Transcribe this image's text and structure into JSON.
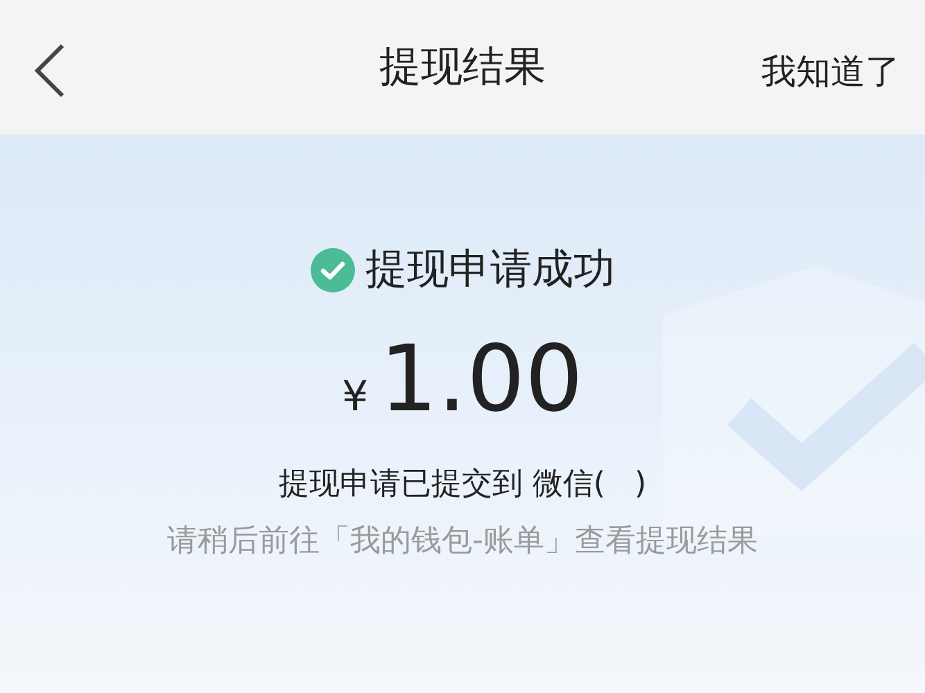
{
  "header": {
    "title": "提现结果",
    "action": "我知道了"
  },
  "result": {
    "status": "提现申请成功",
    "success": true,
    "currency": "¥",
    "amount": "1.00",
    "destination": "提现申请已提交到 微信(   )",
    "hint": "请稍后前往「我的钱包-账单」查看提现结果"
  }
}
